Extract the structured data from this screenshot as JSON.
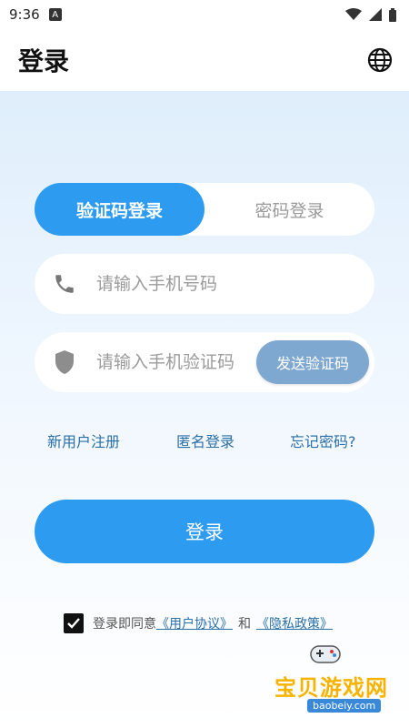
{
  "status": {
    "time": "9:36",
    "badge": "A"
  },
  "appbar": {
    "title": "登录",
    "icon": "globe-icon"
  },
  "tabs": [
    {
      "label": "验证码登录",
      "active": true
    },
    {
      "label": "密码登录",
      "active": false
    }
  ],
  "phone": {
    "placeholder": "请输入手机号码",
    "icon": "phone-icon"
  },
  "code": {
    "placeholder": "请输入手机验证码",
    "icon": "shield-icon",
    "send_label": "发送验证码"
  },
  "links": {
    "register": "新用户注册",
    "anonymous": "匿名登录",
    "forgot": "忘记密码?"
  },
  "login_button": "登录",
  "agreement": {
    "checked": true,
    "prefix": "登录即同意",
    "user_agreement": "《用户协议》",
    "and": "和",
    "privacy": "《隐私政策》"
  },
  "watermark": {
    "title": "宝贝游戏网",
    "url": "baobeiy.com"
  },
  "colors": {
    "accent": "#2d9bf0",
    "send_button": "#7fa8d1",
    "link": "#2b6fa8"
  }
}
